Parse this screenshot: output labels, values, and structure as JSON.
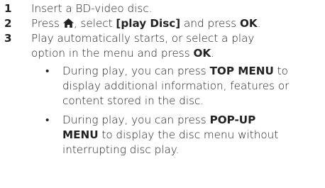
{
  "steps": [
    {
      "number": "1",
      "text": "Insert a BD-video disc."
    },
    {
      "number": "2",
      "press": "Press ",
      "after_icon": ", select ",
      "select_label": "[play Disc]",
      "and_press": " and press ",
      "ok": "OK",
      "end": "."
    },
    {
      "number": "3",
      "line1": "Play automatically starts, or select a play",
      "line2_pre": "option in the menu and press ",
      "ok": "OK",
      "end": "."
    }
  ],
  "bullets": [
    {
      "dot": "•",
      "pre": "During play, you can press ",
      "key": "TOP MENU",
      "post": "to display additional information, features or content stored in the disc."
    },
    {
      "dot": "•",
      "pre": "During play, you can press ",
      "key1": "POP-UP",
      "key2": "MENU",
      "post": " to display the disc menu without interrupting disc play."
    }
  ],
  "icons": {
    "home": "home-icon"
  },
  "colors": {
    "text": "#222222"
  }
}
